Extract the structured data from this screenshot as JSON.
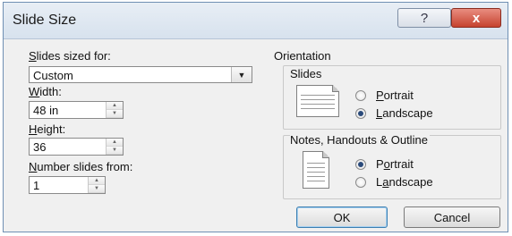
{
  "window": {
    "title": "Slide Size",
    "help_symbol": "?",
    "close_symbol": "x"
  },
  "left": {
    "slides_sized_for_label_u": "S",
    "slides_sized_for_label_rest": "lides sized for:",
    "slides_sized_for_value": "Custom",
    "width_label_u": "W",
    "width_label_rest": "idth:",
    "width_value": "48 in",
    "height_label_u": "H",
    "height_label_rest": "eight:",
    "height_value": "36",
    "number_from_label_u": "N",
    "number_from_label_rest": "umber slides from:",
    "number_from_value": "1"
  },
  "orientation": {
    "group_label": "Orientation",
    "slides": {
      "label": "Slides",
      "portrait_u": "P",
      "portrait_rest": "ortrait",
      "landscape_u": "L",
      "landscape_rest": "andscape",
      "selected": "landscape"
    },
    "notes": {
      "label": "Notes, Handouts & Outline",
      "portrait_pre": "P",
      "portrait_u": "o",
      "portrait_rest": "rtrait",
      "landscape_pre": "L",
      "landscape_u": "a",
      "landscape_rest": "ndscape",
      "selected": "portrait"
    }
  },
  "buttons": {
    "ok": "OK",
    "cancel": "Cancel"
  }
}
